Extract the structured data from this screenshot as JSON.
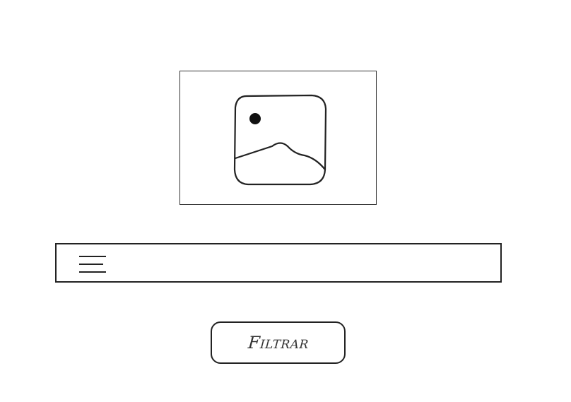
{
  "image_placeholder": {
    "icon": "image-icon"
  },
  "dropdown": {
    "icon": "menu-icon",
    "selected_value": ""
  },
  "filter_button": {
    "label": "Filtrar"
  },
  "colors": {
    "stroke": "#222222",
    "background": "#ffffff"
  }
}
